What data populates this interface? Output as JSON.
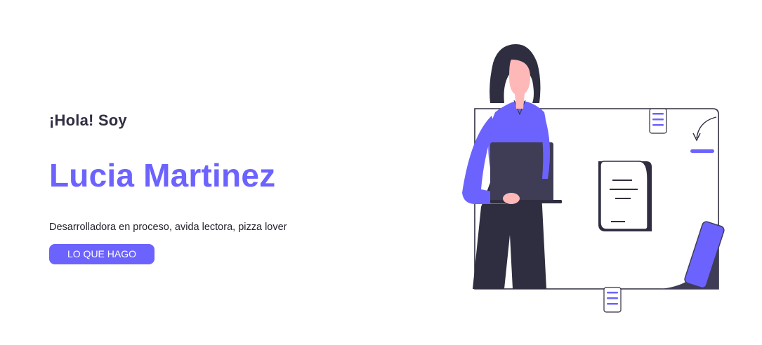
{
  "hero": {
    "greeting": "¡Hola! Soy",
    "name": "Lucia Martinez",
    "tagline": "Desarrolladora en proceso, avida lectora, pizza lover",
    "cta_label": "LO QUE HAGO"
  },
  "illustration": {
    "icon": "woman-with-laptop-illustration"
  },
  "colors": {
    "accent": "#6c63ff",
    "dark": "#2f2e41",
    "skin": "#ffb8b8",
    "background": "#ffffff"
  }
}
